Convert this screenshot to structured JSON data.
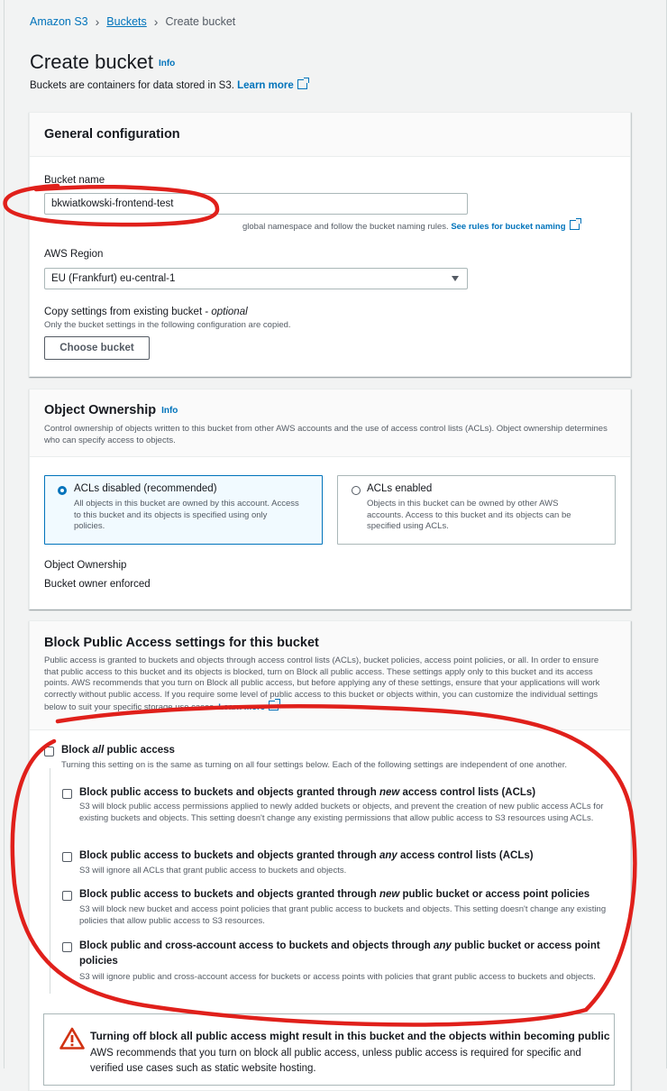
{
  "breadcrumbs": [
    "Amazon S3",
    "Buckets",
    "Create bucket"
  ],
  "page_title": "Create bucket",
  "info_label": "Info",
  "subtitle": "Buckets are containers for data stored in S3.",
  "learn_more": "Learn more",
  "general": {
    "title": "General configuration",
    "bucket_name_label": "Bucket name",
    "bucket_name_value": "bkwiatkowski-frontend-test",
    "bucket_name_hint_visible": "global namespace and follow the bucket naming rules.",
    "bucket_name_hint_link": "See rules for bucket naming",
    "region_label": "AWS Region",
    "region_value": "EU (Frankfurt) eu-central-1",
    "copy_label": "Copy settings from existing bucket - ",
    "copy_optional": "optional",
    "copy_desc": "Only the bucket settings in the following configuration are copied.",
    "choose_button": "Choose bucket"
  },
  "ownership": {
    "title": "Object Ownership",
    "desc": "Control ownership of objects written to this bucket from other AWS accounts and the use of access control lists (ACLs). Object ownership determines who can specify access to objects.",
    "opt1_label": "ACLs disabled (recommended)",
    "opt1_desc": "All objects in this bucket are owned by this account. Access to this bucket and its objects is specified using only policies.",
    "opt2_label": "ACLs enabled",
    "opt2_desc": "Objects in this bucket can be owned by other AWS accounts. Access to this bucket and its objects can be specified using ACLs.",
    "field_label": "Object Ownership",
    "field_value": "Bucket owner enforced"
  },
  "block": {
    "title": "Block Public Access settings for this bucket",
    "desc": "Public access is granted to buckets and objects through access control lists (ACLs), bucket policies, access point policies, or all. In order to ensure that public access to this bucket and its objects is blocked, turn on Block all public access. These settings apply only to this bucket and its access points. AWS recommends that you turn on Block all public access, but before applying any of these settings, ensure that your applications will work correctly without public access. If you require some level of public access to this bucket or objects within, you can customize the individual settings below to suit your specific storage use cases.",
    "all_pre": "Block ",
    "all_em": "all",
    "all_post": " public access",
    "all_desc": "Turning this setting on is the same as turning on all four settings below. Each of the following settings are independent of one another.",
    "opt1_pre": "Block public access to buckets and objects granted through ",
    "opt1_em": "new",
    "opt1_post": " access control lists (ACLs)",
    "opt1_desc": "S3 will block public access permissions applied to newly added buckets or objects, and prevent the creation of new public access ACLs for existing buckets and objects. This setting doesn't change any existing permissions that allow public access to S3 resources using ACLs.",
    "opt2_pre": "Block public access to buckets and objects granted through ",
    "opt2_em": "any",
    "opt2_post": " access control lists (ACLs)",
    "opt2_desc": "S3 will ignore all ACLs that grant public access to buckets and objects.",
    "opt3_pre": "Block public access to buckets and objects granted through ",
    "opt3_em": "new",
    "opt3_post": " public bucket or access point policies",
    "opt3_desc": "S3 will block new bucket and access point policies that grant public access to buckets and objects. This setting doesn't change any existing policies that allow public access to S3 resources.",
    "opt4_pre": "Block public and cross-account access to buckets and objects through ",
    "opt4_em": "any",
    "opt4_post": " public bucket or access point policies",
    "opt4_desc": "S3 will ignore public and cross-account access for buckets or access points with policies that grant public access to buckets and objects."
  },
  "warning": {
    "title": "Turning off block all public access might result in this bucket and the objects within becoming public",
    "text": "AWS recommends that you turn on block all public access, unless public access is required for specific and verified use cases such as static website hosting."
  },
  "colors": {
    "link": "#0073bb",
    "annotation": "#e0201b",
    "warning": "#d13212"
  }
}
